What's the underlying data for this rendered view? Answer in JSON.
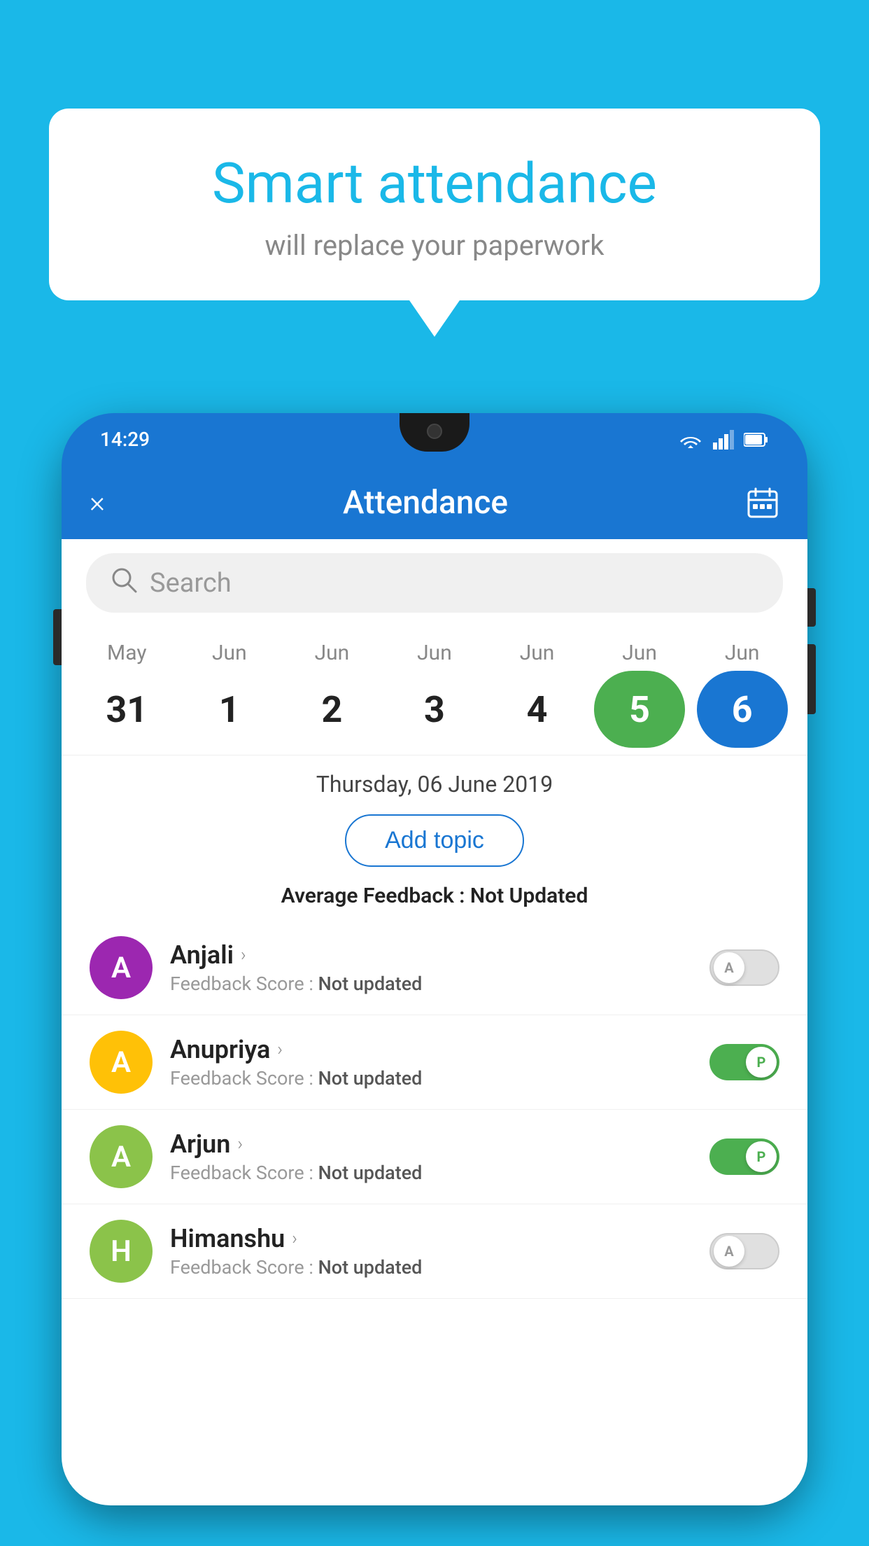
{
  "background_color": "#1ab8e8",
  "speech_bubble": {
    "title": "Smart attendance",
    "subtitle": "will replace your paperwork"
  },
  "status_bar": {
    "time": "14:29",
    "wifi": "▾",
    "signal": "▴",
    "battery": "▪"
  },
  "header": {
    "title": "Attendance",
    "close_label": "×",
    "calendar_icon": "calendar"
  },
  "search": {
    "placeholder": "Search"
  },
  "calendar": {
    "dates": [
      {
        "month": "May",
        "day": "31",
        "state": "normal"
      },
      {
        "month": "Jun",
        "day": "1",
        "state": "normal"
      },
      {
        "month": "Jun",
        "day": "2",
        "state": "normal"
      },
      {
        "month": "Jun",
        "day": "3",
        "state": "normal"
      },
      {
        "month": "Jun",
        "day": "4",
        "state": "normal"
      },
      {
        "month": "Jun",
        "day": "5",
        "state": "today"
      },
      {
        "month": "Jun",
        "day": "6",
        "state": "selected"
      }
    ]
  },
  "selected_date": "Thursday, 06 June 2019",
  "add_topic_label": "Add topic",
  "average_feedback_label": "Average Feedback :",
  "average_feedback_value": "Not Updated",
  "students": [
    {
      "name": "Anjali",
      "avatar_letter": "A",
      "avatar_color": "#9c27b0",
      "feedback_label": "Feedback Score :",
      "feedback_value": "Not updated",
      "toggle_state": "off",
      "toggle_label": "A"
    },
    {
      "name": "Anupriya",
      "avatar_letter": "A",
      "avatar_color": "#ffc107",
      "feedback_label": "Feedback Score :",
      "feedback_value": "Not updated",
      "toggle_state": "on",
      "toggle_label": "P"
    },
    {
      "name": "Arjun",
      "avatar_letter": "A",
      "avatar_color": "#8bc34a",
      "feedback_label": "Feedback Score :",
      "feedback_value": "Not updated",
      "toggle_state": "on",
      "toggle_label": "P"
    },
    {
      "name": "Himanshu",
      "avatar_letter": "H",
      "avatar_color": "#8bc34a",
      "feedback_label": "Feedback Score :",
      "feedback_value": "Not updated",
      "toggle_state": "off",
      "toggle_label": "A"
    }
  ]
}
